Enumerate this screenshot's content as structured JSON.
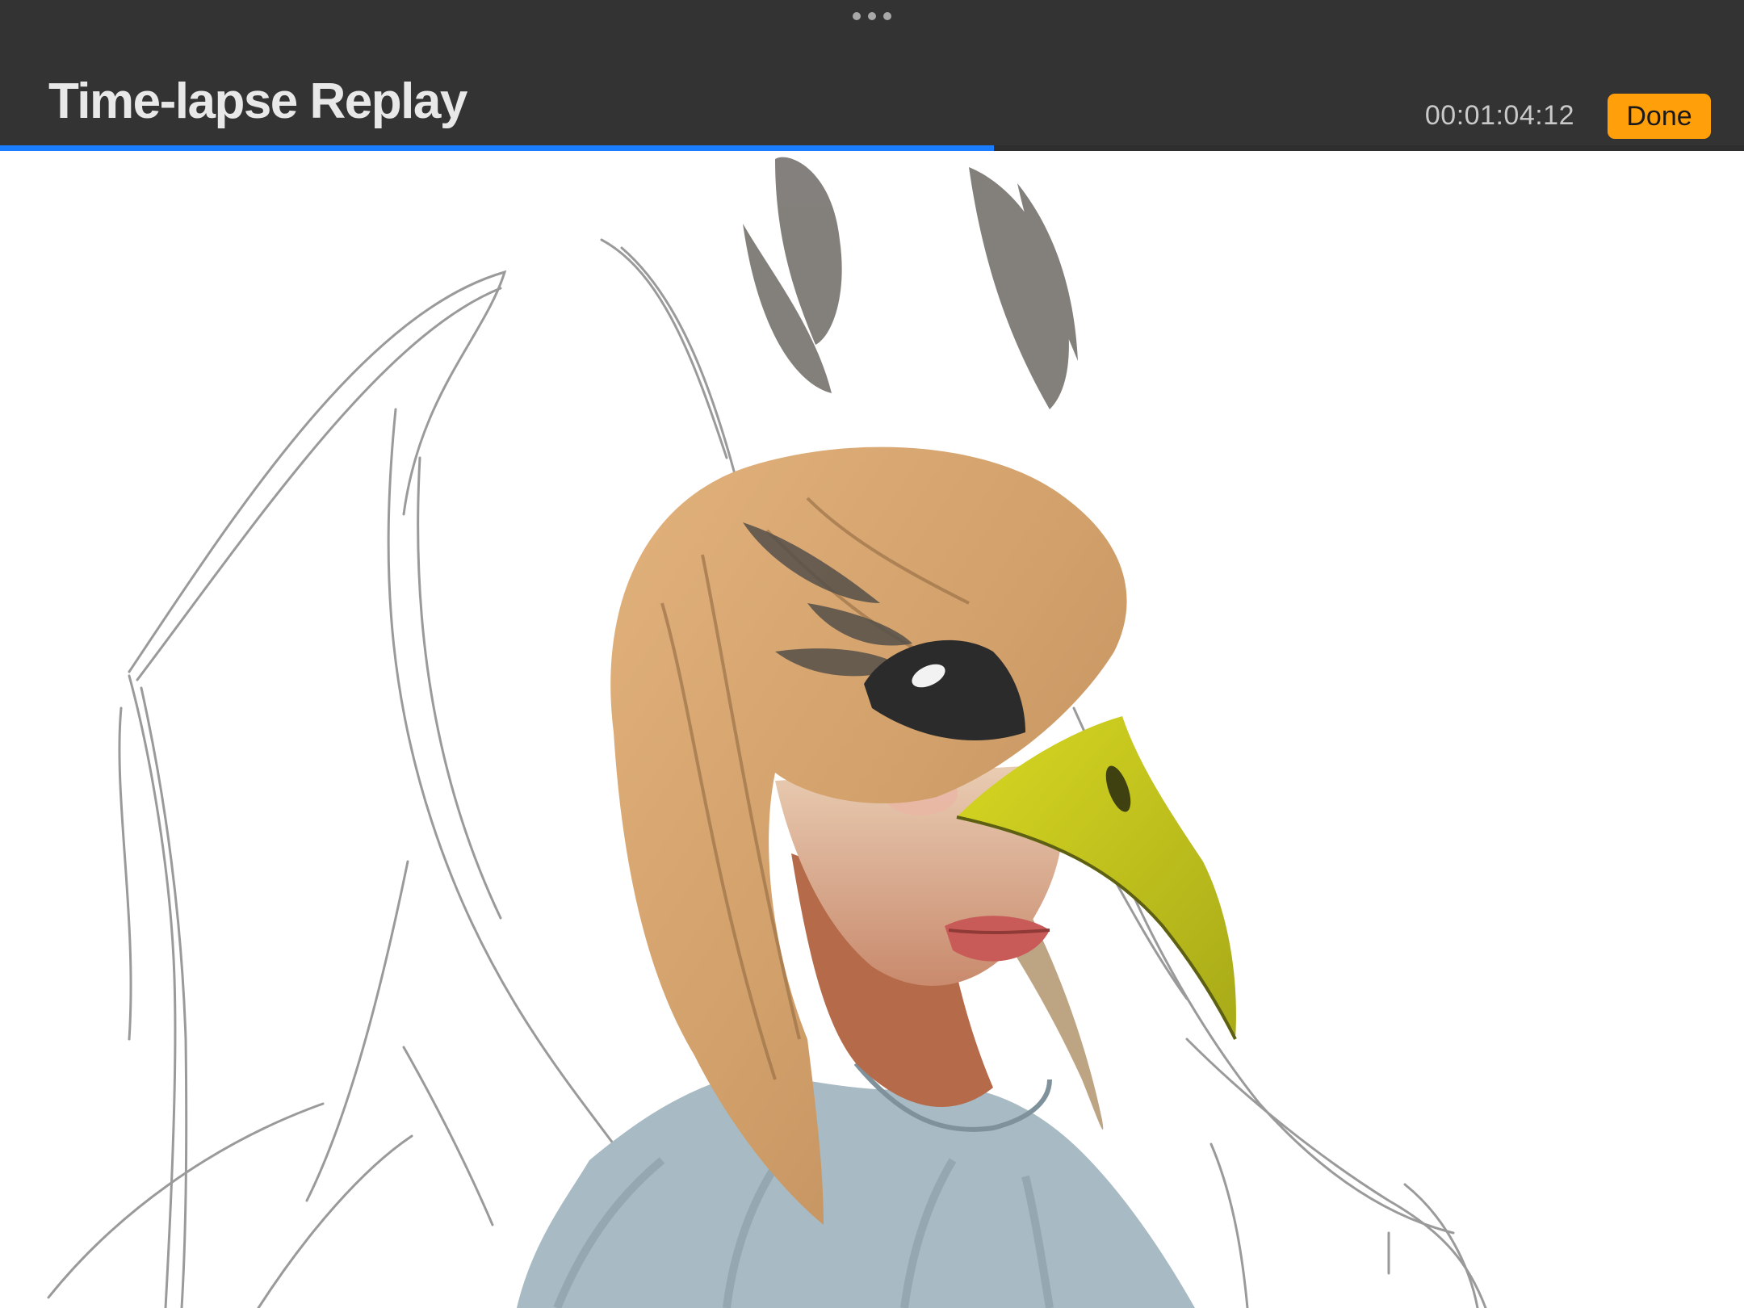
{
  "header": {
    "title": "Time-lapse Replay",
    "timecode": "00:01:04:12",
    "done_label": "Done",
    "more_icon": "ellipsis-icon"
  },
  "playback": {
    "progress": 0.57
  },
  "colors": {
    "header_bg": "#333333",
    "accent": "#ff9f0a",
    "progress": "#1a7cff",
    "canvas_bg": "#ffffff"
  }
}
